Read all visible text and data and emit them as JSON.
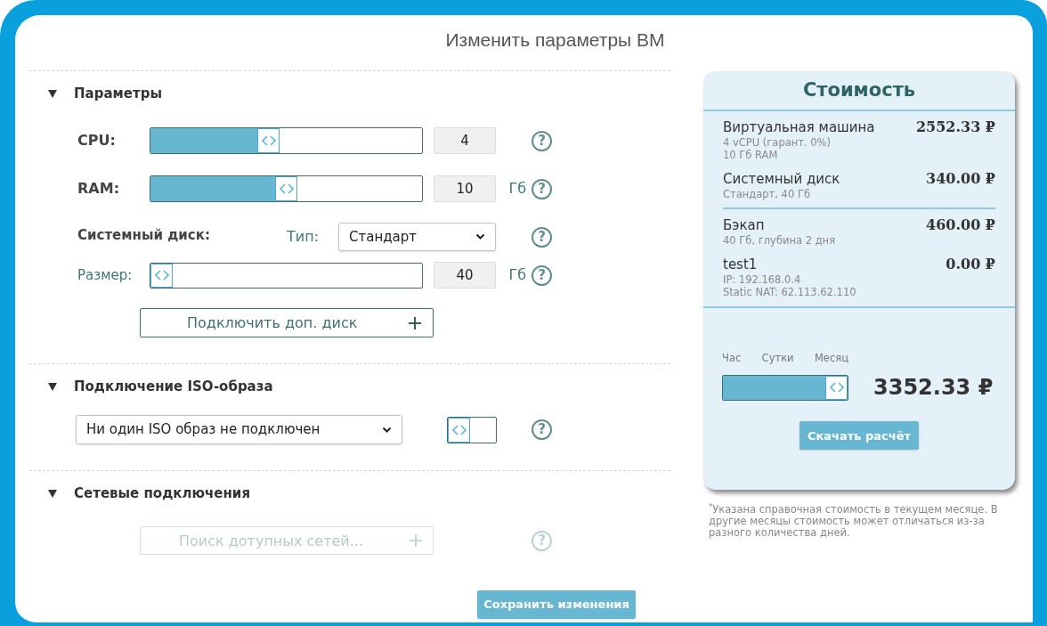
{
  "title": "Изменить параметры ВМ",
  "params": {
    "title": "Параметры",
    "expanded": true,
    "cpu": {
      "label": "CPU:",
      "level": 0.43,
      "value": "4",
      "help": "?"
    },
    "ram": {
      "label": "RAM:",
      "level": 0.5,
      "value": "10",
      "unit": "Гб",
      "help": "?"
    },
    "disk": {
      "label": "Системный диск:",
      "type_label": "Тип:",
      "type_value": "Стандарт",
      "type_help": "?",
      "size_label": "Размер:",
      "level": 0,
      "value": "40",
      "unit": "Гб",
      "help": "?"
    },
    "add_disk_button": "Подключить доп. диск"
  },
  "iso": {
    "title": "Подключение ISO-образа",
    "expanded": true,
    "select_value": "Ни один ISO образ не подключен",
    "toggle": {
      "level": 0
    },
    "help": "?"
  },
  "network": {
    "title": "Сетевые подключения",
    "expanded": true,
    "search_placeholder": "Поиск дотупных сетей...",
    "disabled": true,
    "help": "?"
  },
  "save_button": "Сохранить изменения",
  "cost": {
    "title": "Стоимость",
    "groups": [
      [
        {
          "name": "Виртуальная машина",
          "details": [
            "4 vCPU (гарант. 0%)",
            "10 Гб RAM"
          ],
          "price": "2552.33 ₽"
        },
        {
          "name": "Системный диск",
          "details": [
            "Стандарт, 40 Гб"
          ],
          "price": "340.00 ₽"
        }
      ],
      [
        {
          "name": "Бэкап",
          "details": [
            "40 Гб, глубина 2 дня"
          ],
          "price": "460.00 ₽"
        },
        {
          "name": "test1",
          "details": [
            "IP: 192.168.0.4",
            "Static NAT: 62.113.62.110"
          ],
          "price": "0.00 ₽"
        }
      ]
    ],
    "periods": [
      "Час",
      "Сутки",
      "Месяц"
    ],
    "period_slider": {
      "level": 1
    },
    "total": "3352.33 ₽",
    "download_button": "Скачать расчёт"
  },
  "footnote": "$^{*}$Указана справочная стоимость в текущем месяце. В другие месяцы стоимость может отличаться из-за разного количества дней."
}
